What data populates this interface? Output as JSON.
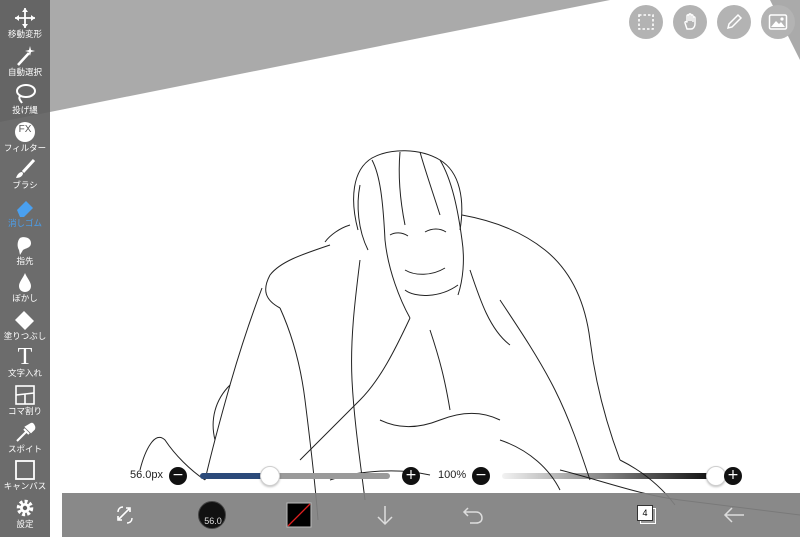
{
  "tools": [
    {
      "label": "移動変形",
      "icon": "move-icon"
    },
    {
      "label": "自動選択",
      "icon": "magic-wand-icon"
    },
    {
      "label": "投げ縄",
      "icon": "lasso-icon"
    },
    {
      "label": "フィルター",
      "icon": "fx-filter-icon",
      "badge": "FX"
    },
    {
      "label": "ブラシ",
      "icon": "brush-icon"
    },
    {
      "label": "消しゴム",
      "icon": "eraser-icon",
      "active": true
    },
    {
      "label": "指先",
      "icon": "finger-smudge-icon"
    },
    {
      "label": "ぼかし",
      "icon": "blur-drop-icon"
    },
    {
      "label": "塗りつぶし",
      "icon": "bucket-fill-icon"
    },
    {
      "label": "文字入れ",
      "icon": "text-icon",
      "glyph": "T"
    },
    {
      "label": "コマ割り",
      "icon": "frame-divider-icon"
    },
    {
      "label": "スポイト",
      "icon": "eyedropper-icon"
    },
    {
      "label": "キャンバス",
      "icon": "canvas-icon"
    },
    {
      "label": "設定",
      "icon": "settings-gear-icon"
    }
  ],
  "top_buttons": [
    "selection-icon",
    "hand-icon",
    "pen-icon",
    "image-icon"
  ],
  "size_slider": {
    "value_text": "56.0px",
    "fraction": 0.37,
    "minus": "−",
    "plus": "+"
  },
  "opacity_slider": {
    "value_text": "100%",
    "fraction": 1.0,
    "minus": "−",
    "plus": "+"
  },
  "bottom": {
    "brush_size_text": "56.0",
    "layer_count": "4"
  },
  "colors": {
    "toolbar_bg": "#606060",
    "active_tool": "#4aa0f0",
    "bottom_bar": "#808080",
    "size_track_fill": "#2b4a7a",
    "track_bg": "#9a9a9a"
  }
}
